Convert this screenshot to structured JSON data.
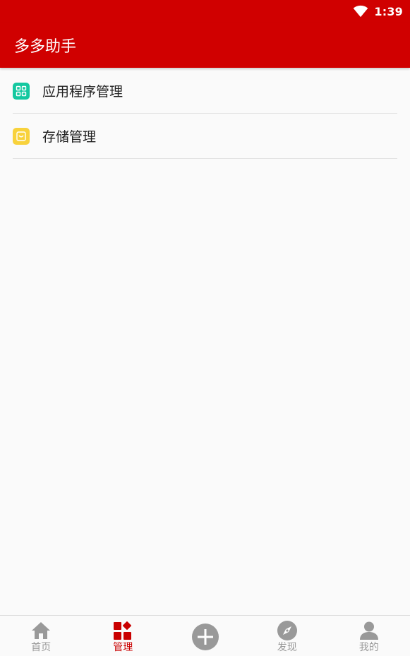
{
  "status_bar": {
    "time": "1:39",
    "wifi_icon": "wifi-icon"
  },
  "app_bar": {
    "title": "多多助手"
  },
  "list": {
    "items": [
      {
        "label": "应用程序管理",
        "icon": "grid-icon",
        "color": "#14c8a0"
      },
      {
        "label": "存储管理",
        "icon": "storage-icon",
        "color": "#f8d23c"
      }
    ]
  },
  "bottom_nav": {
    "items": [
      {
        "label": "首页",
        "icon": "home-icon",
        "active": false
      },
      {
        "label": "管理",
        "icon": "manage-icon",
        "active": true
      },
      {
        "label": "",
        "icon": "add-icon",
        "active": false
      },
      {
        "label": "发现",
        "icon": "compass-icon",
        "active": false
      },
      {
        "label": "我的",
        "icon": "person-icon",
        "active": false
      }
    ]
  },
  "colors": {
    "primary": "#d00000",
    "active_tab": "#c90000",
    "inactive_tab": "#999999"
  }
}
